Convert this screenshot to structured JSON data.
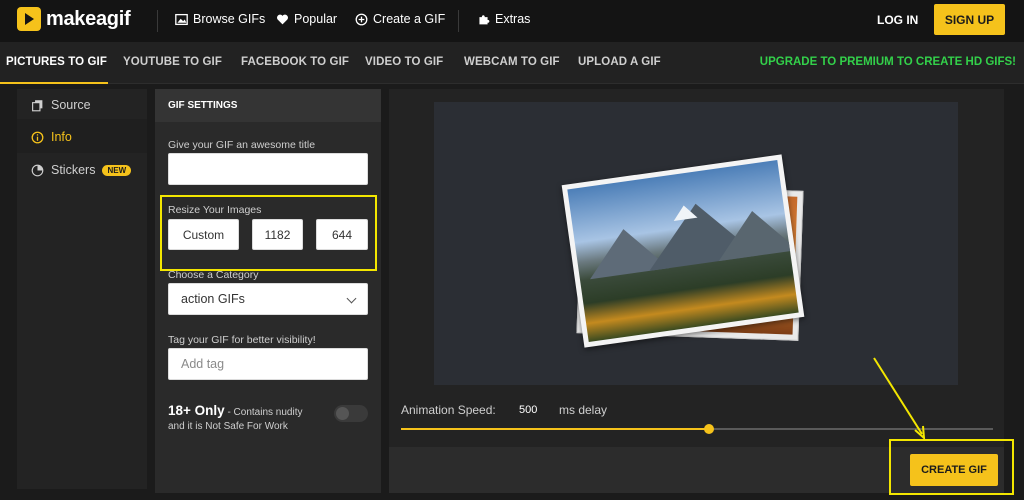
{
  "app": {
    "logo_text": "makeagif"
  },
  "header": {
    "nav": [
      {
        "label": "Browse GIFs",
        "icon": "image-icon"
      },
      {
        "label": "Popular",
        "icon": "heart-icon"
      },
      {
        "label": "Create a GIF",
        "icon": "plus-circle-icon"
      },
      {
        "label": "Extras",
        "icon": "puzzle-icon"
      }
    ],
    "login_label": "LOG IN",
    "signup_label": "SIGN UP"
  },
  "subnav": {
    "tabs": [
      {
        "label": "PICTURES TO GIF",
        "active": true
      },
      {
        "label": "YOUTUBE TO GIF"
      },
      {
        "label": "FACEBOOK TO GIF"
      },
      {
        "label": "VIDEO TO GIF"
      },
      {
        "label": "WEBCAM TO GIF"
      },
      {
        "label": "UPLOAD A GIF"
      }
    ],
    "premium_label": "UPGRADE TO PREMIUM TO CREATE HD GIFS!"
  },
  "sidebar": {
    "items": [
      {
        "label": "Source",
        "icon": "copy-icon"
      },
      {
        "label": "Info",
        "icon": "info-icon",
        "active": true
      },
      {
        "label": "Stickers",
        "icon": "sticker-icon",
        "badge": "NEW"
      }
    ]
  },
  "settings": {
    "title": "GIF SETTINGS",
    "title_field": {
      "label": "Give your GIF an awesome title",
      "value": ""
    },
    "resize": {
      "label": "Resize Your Images",
      "mode": "Custom",
      "width": "1182",
      "height": "644"
    },
    "category": {
      "label": "Choose a Category",
      "value": "action GIFs"
    },
    "tag": {
      "label": "Tag your GIF for better visibility!",
      "placeholder": "Add tag"
    },
    "nsfw": {
      "title": "18+ Only",
      "desc_inline": " - Contains nudity",
      "desc_line2": "and it is Not Safe For Work",
      "enabled": false
    }
  },
  "preview": {
    "speed_label": "Animation Speed:",
    "speed_value": "500",
    "speed_unit": "ms delay",
    "speed_fraction": 0.52,
    "create_label": "CREATE GIF"
  },
  "colors": {
    "accent": "#f5c21b",
    "premium": "#33d04a",
    "highlight": "#f3e600"
  }
}
